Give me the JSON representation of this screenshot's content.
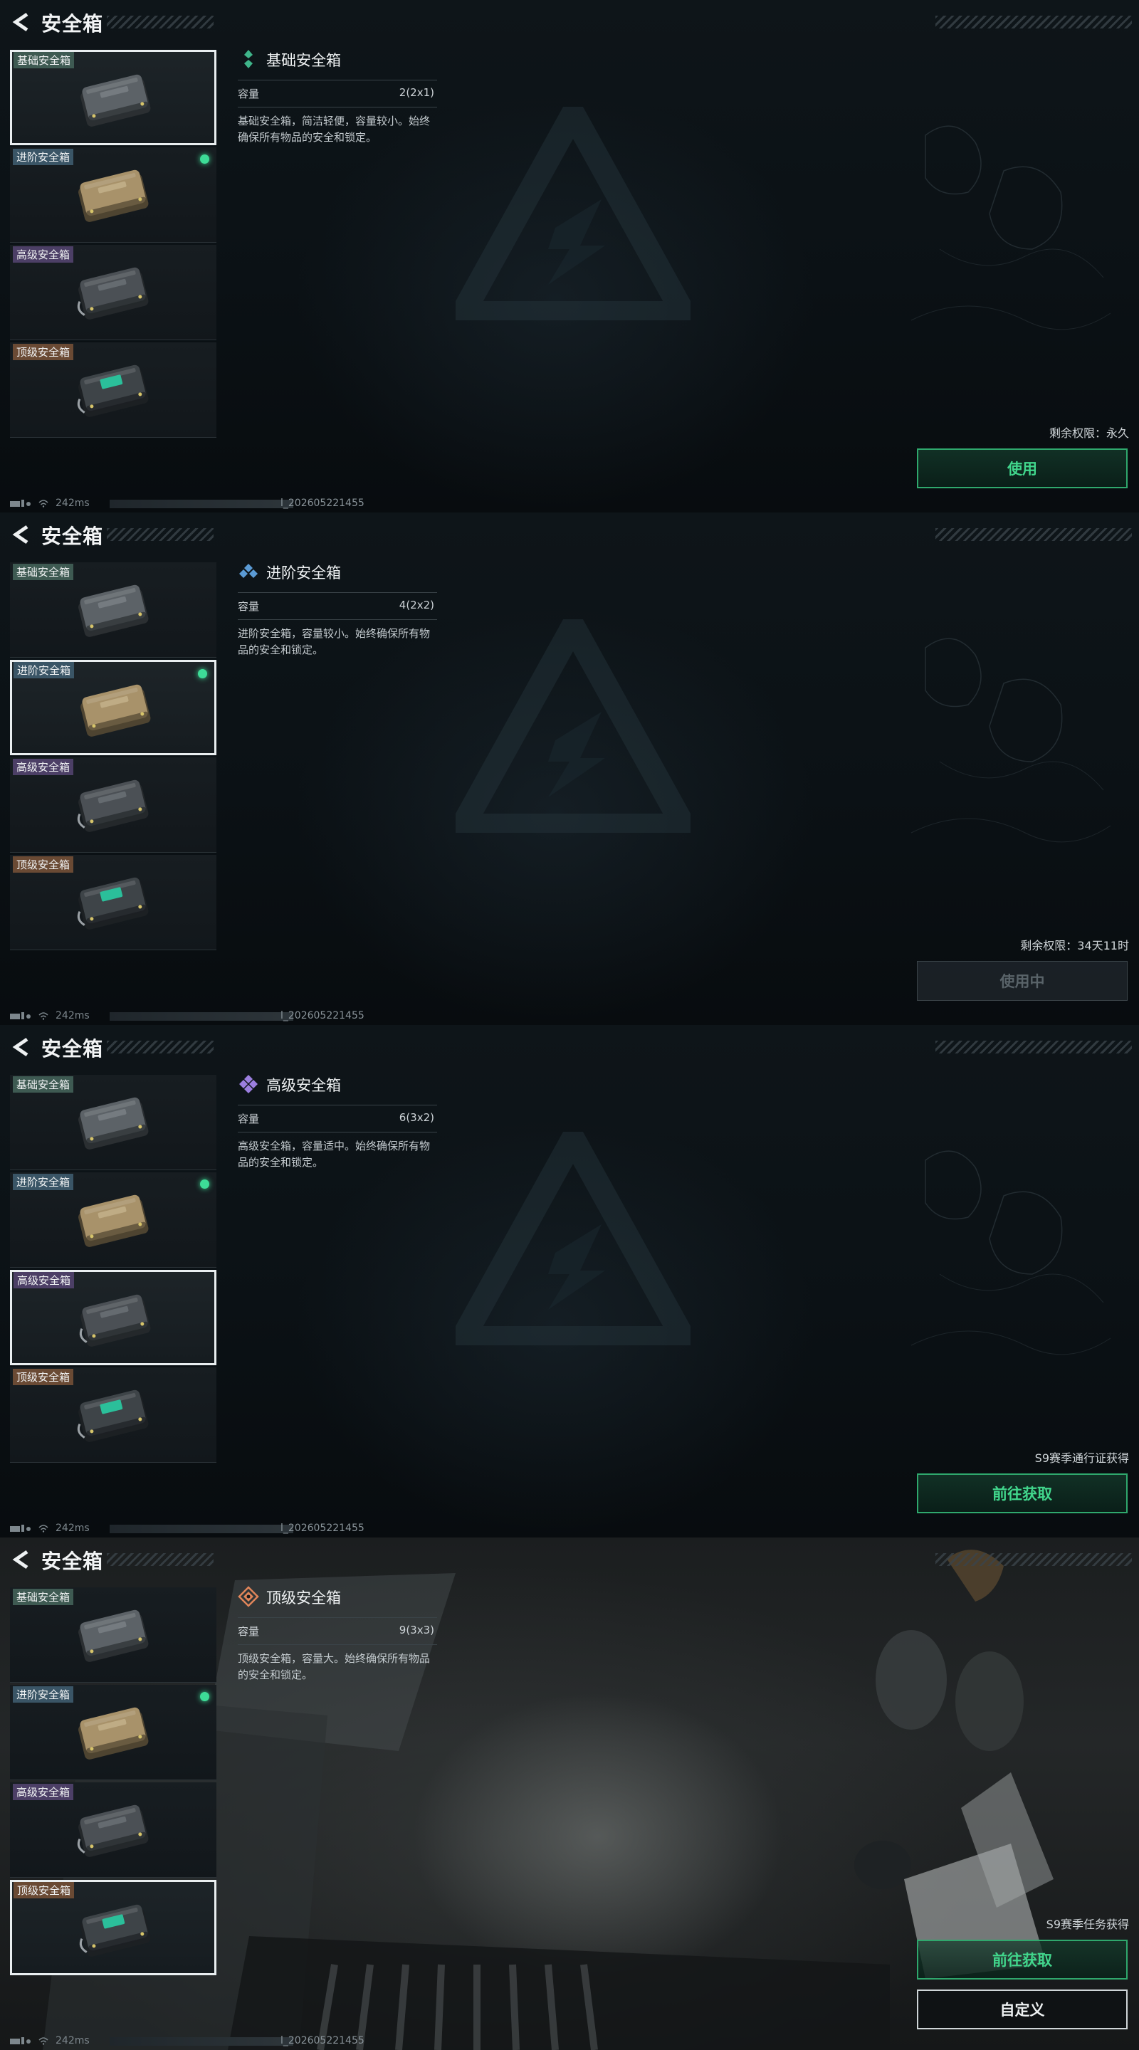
{
  "page_title": "安全箱",
  "status": {
    "latency": "242ms",
    "build": "l_202605221455"
  },
  "categories": [
    {
      "label": "基础安全箱",
      "tier": "t1"
    },
    {
      "label": "进阶安全箱",
      "tier": "t2"
    },
    {
      "label": "高级安全箱",
      "tier": "t3"
    },
    {
      "label": "顶级安全箱",
      "tier": "t4"
    }
  ],
  "colors": {
    "accent_green": "#41d68c",
    "basic": "#3fb58a",
    "advanced": "#5b9bd5",
    "senior": "#9c7fe0",
    "top": "#e0855a"
  },
  "panels": [
    {
      "name": "基础安全箱",
      "capacity_label": "容量",
      "capacity_value": "2(2x1)",
      "description": "基础安全箱，简洁轻便，容量较小。始终确保所有物品的安全和锁定。",
      "note": "剩余权限：永久",
      "button": "使用",
      "icon": "basic-rank-icon"
    },
    {
      "name": "进阶安全箱",
      "capacity_label": "容量",
      "capacity_value": "4(2x2)",
      "description": "进阶安全箱，容量较小。始终确保所有物品的安全和锁定。",
      "note": "剩余权限：34天11时",
      "button": "使用中",
      "icon": "advanced-rank-icon"
    },
    {
      "name": "高级安全箱",
      "capacity_label": "容量",
      "capacity_value": "6(3x2)",
      "description": "高级安全箱，容量适中。始终确保所有物品的安全和锁定。",
      "note": "S9赛季通行证获得",
      "button": "前往获取",
      "icon": "senior-rank-icon"
    },
    {
      "name": "顶级安全箱",
      "capacity_label": "容量",
      "capacity_value": "9(3x3)",
      "description": "顶级安全箱，容量大。始终确保所有物品的安全和锁定。",
      "note": "S9赛季任务获得",
      "button": "前往获取",
      "button2": "自定义",
      "icon": "top-rank-icon"
    }
  ]
}
